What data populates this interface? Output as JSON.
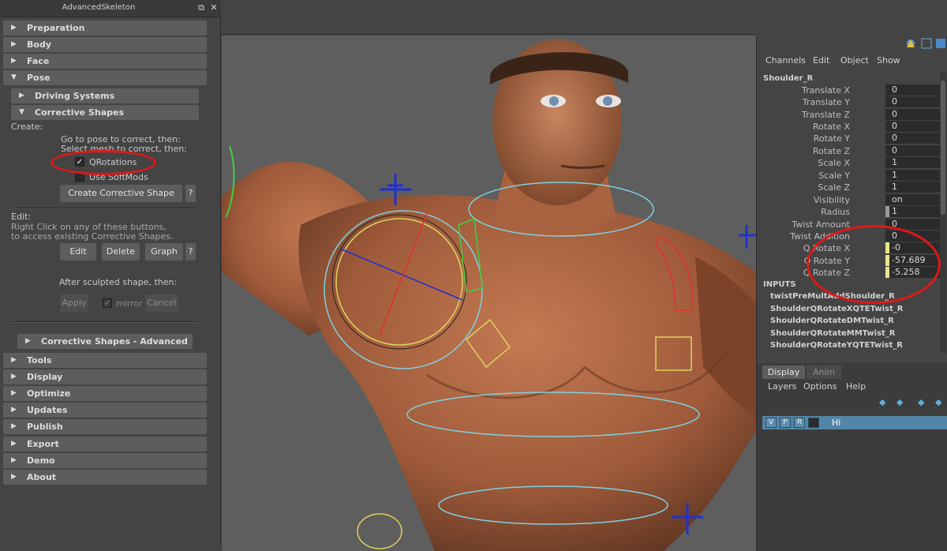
{
  "panel": {
    "title": "AdvancedSkeleton",
    "frames_top": [
      "Preparation",
      "Body",
      "Face",
      "Pose"
    ],
    "subframes": [
      "Driving Systems",
      "Corrective Shapes"
    ],
    "create_label": "Create:",
    "instr1": "Go to pose to correct, then:",
    "instr2": "Select mesh to correct, then:",
    "qrotations": {
      "label": "QRotations",
      "checked": true
    },
    "softmods": {
      "label": "Use SoftMods",
      "checked": false
    },
    "create_btn": "Create Corrective Shape",
    "help": "?",
    "edit_label": "Edit:",
    "edit_note1": "Right Click on any of these buttons,",
    "edit_note2": "to access existing Corrective Shapes.",
    "edit_btn": "Edit",
    "delete_btn": "Delete",
    "graph_btn": "Graph",
    "after_label": "After sculpted shape, then:",
    "apply_btn": "Apply",
    "mirror": {
      "label": "mirror",
      "checked": true
    },
    "cancel_btn": "Cancel",
    "advanced_frame": "Corrective Shapes - Advanced",
    "frames_bottom": [
      "Tools",
      "Display",
      "Optimize",
      "Updates",
      "Publish",
      "Export",
      "Demo",
      "About"
    ]
  },
  "channel_box": {
    "menu": [
      "Channels",
      "Edit",
      "Object",
      "Show"
    ],
    "object": "Shoulder_R",
    "attributes": [
      {
        "label": "Translate X",
        "value": "0"
      },
      {
        "label": "Translate Y",
        "value": "0"
      },
      {
        "label": "Translate Z",
        "value": "0"
      },
      {
        "label": "Rotate X",
        "value": "0"
      },
      {
        "label": "Rotate Y",
        "value": "0"
      },
      {
        "label": "Rotate Z",
        "value": "0"
      },
      {
        "label": "Scale X",
        "value": "1"
      },
      {
        "label": "Scale Y",
        "value": "1"
      },
      {
        "label": "Scale Z",
        "value": "1"
      },
      {
        "label": "Visibility",
        "value": "on"
      },
      {
        "label": "Radius",
        "value": "1"
      },
      {
        "label": "Twist Amount",
        "value": "0"
      },
      {
        "label": "Twist Addition",
        "value": "0"
      },
      {
        "label": "Q Rotate X",
        "value": "-0"
      },
      {
        "label": "Q Rotate Y",
        "value": "-57.689"
      },
      {
        "label": "Q Rotate Z",
        "value": "-5.258"
      }
    ],
    "inputs_title": "INPUTS",
    "inputs": [
      "twistPreMultAddShoulder_R",
      "ShoulderQRotateXQTETwist_R",
      "ShoulderQRotateDMTwist_R",
      "ShoulderQRotateMMTwist_R",
      "ShoulderQRotateYQTETwist_R"
    ]
  },
  "layer_editor": {
    "tabs": [
      "Display",
      "Anim"
    ],
    "menu": [
      "Layers",
      "Options",
      "Help"
    ],
    "layer": {
      "v": "V",
      "p": "P",
      "r": "R",
      "name": "Hi"
    }
  },
  "colors": {
    "highlight_ring": "#e01818",
    "layer_selected": "#5385a6",
    "panel_bg": "#444444"
  }
}
